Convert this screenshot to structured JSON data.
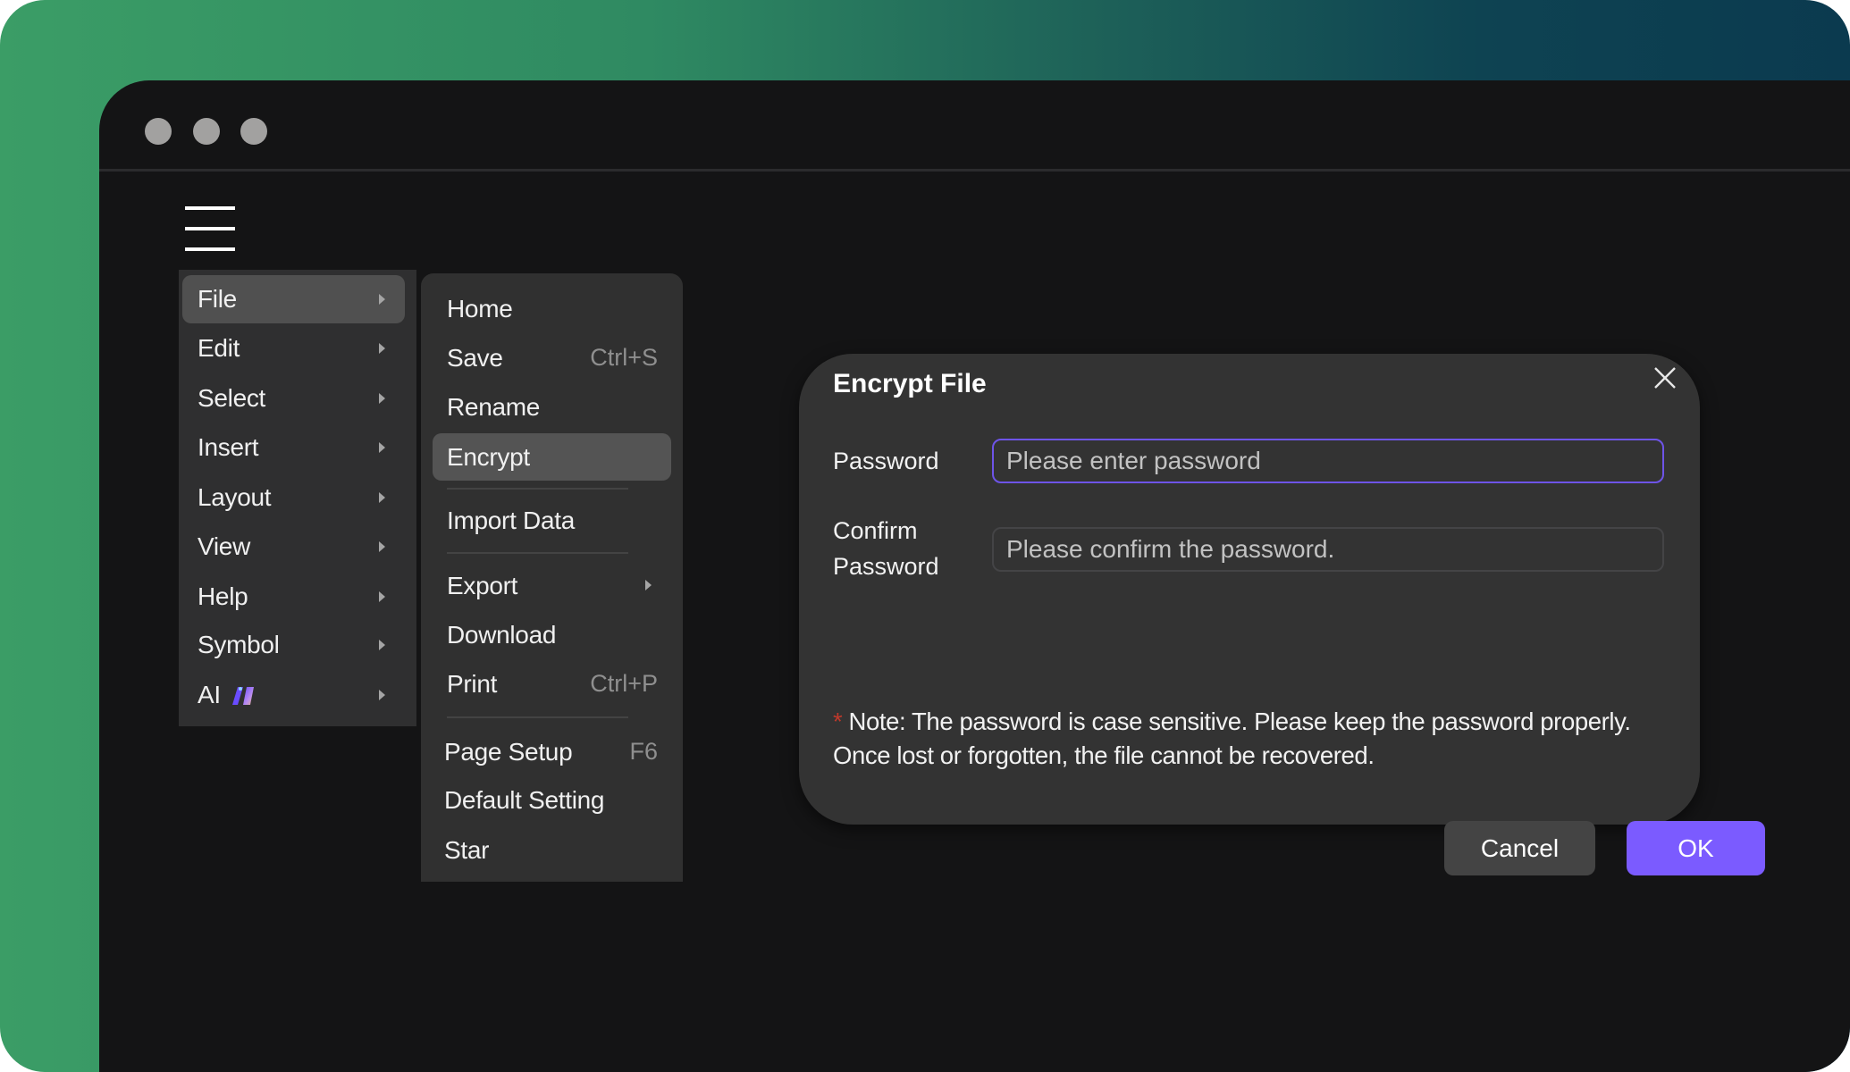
{
  "window": {
    "traffic_lights": [
      "close",
      "minimize",
      "maximize"
    ],
    "menu_icon": "hamburger-menu-icon"
  },
  "main_menu": {
    "items": [
      {
        "label": "File",
        "active": true,
        "has_submenu": true
      },
      {
        "label": "Edit",
        "active": false,
        "has_submenu": true
      },
      {
        "label": "Select",
        "active": false,
        "has_submenu": true
      },
      {
        "label": "Insert",
        "active": false,
        "has_submenu": true
      },
      {
        "label": "Layout",
        "active": false,
        "has_submenu": true
      },
      {
        "label": "View",
        "active": false,
        "has_submenu": true
      },
      {
        "label": "Help",
        "active": false,
        "has_submenu": true
      },
      {
        "label": "Symbol",
        "active": false,
        "has_submenu": true
      },
      {
        "label": "AI",
        "active": false,
        "has_submenu": true,
        "icon": "ai-sparkle-icon"
      }
    ]
  },
  "file_submenu": {
    "items": [
      {
        "label": "Home",
        "shortcut": ""
      },
      {
        "label": "Save",
        "shortcut": "Ctrl+S"
      },
      {
        "label": "Rename",
        "shortcut": ""
      },
      {
        "label": "Encrypt",
        "shortcut": "",
        "active": true
      },
      {
        "label": "Import Data",
        "shortcut": ""
      },
      {
        "label": "Export",
        "shortcut": "",
        "has_submenu": true
      },
      {
        "label": "Download",
        "shortcut": ""
      },
      {
        "label": "Print",
        "shortcut": "Ctrl+P"
      },
      {
        "label": "Page Setup",
        "shortcut": "F6"
      },
      {
        "label": "Default Setting",
        "shortcut": ""
      },
      {
        "label": "Star",
        "shortcut": ""
      }
    ]
  },
  "dialog": {
    "title": "Encrypt File",
    "password_label": "Password",
    "password_value": "",
    "password_placeholder": "Please enter password",
    "confirm_label_line1": "Confirm",
    "confirm_label_line2": "Password",
    "confirm_value": "",
    "confirm_placeholder": "Please confirm the password.",
    "note_asterisk": "*",
    "note_text": " Note: The password is case sensitive. Please keep the password properly. Once lost or forgotten, the file cannot be recovered.",
    "cancel_label": "Cancel",
    "ok_label": "OK"
  },
  "colors": {
    "accent": "#7b5bff",
    "focus_border": "#6e54e8",
    "note_asterisk": "#c0392b",
    "window_bg": "#141415",
    "menu_bg": "#2f2f30",
    "dialog_bg": "#333333"
  }
}
